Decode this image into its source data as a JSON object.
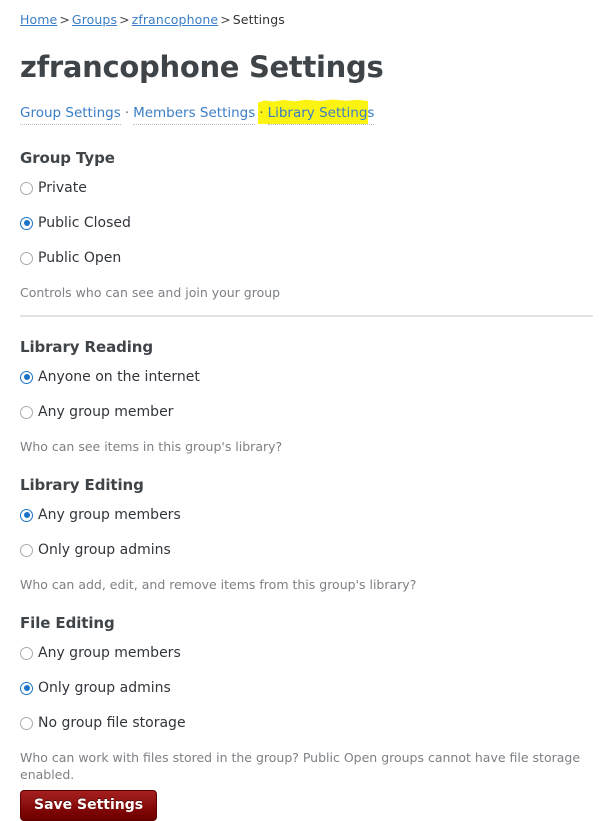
{
  "breadcrumb": {
    "items": [
      {
        "label": "Home",
        "link": true
      },
      {
        "label": "Groups",
        "link": true
      },
      {
        "label": "zfrancophone",
        "link": true
      },
      {
        "label": "Settings",
        "link": false
      }
    ],
    "separator": ">"
  },
  "header": {
    "title": "zfrancophone Settings"
  },
  "tabs": {
    "separator": "·",
    "items": [
      {
        "label": "Group Settings",
        "highlighted": false
      },
      {
        "label": "Members Settings",
        "highlighted": false
      },
      {
        "label": "Library Settings",
        "highlighted": true
      }
    ]
  },
  "sections": [
    {
      "title": "Group Type",
      "options": [
        {
          "label": "Private",
          "selected": false
        },
        {
          "label": "Public Closed",
          "selected": true
        },
        {
          "label": "Public Open",
          "selected": false
        }
      ],
      "helper": "Controls who can see and join your group"
    },
    {
      "title": "Library Reading",
      "options": [
        {
          "label": "Anyone on the internet",
          "selected": true
        },
        {
          "label": "Any group member",
          "selected": false
        }
      ],
      "helper": "Who can see items in this group's library?"
    },
    {
      "title": "Library Editing",
      "options": [
        {
          "label": "Any group members",
          "selected": true
        },
        {
          "label": "Only group admins",
          "selected": false
        }
      ],
      "helper": "Who can add, edit, and remove items from this group's library?"
    },
    {
      "title": "File Editing",
      "options": [
        {
          "label": "Any group members",
          "selected": false
        },
        {
          "label": "Only group admins",
          "selected": true
        },
        {
          "label": "No group file storage",
          "selected": false
        }
      ],
      "helper": "Who can work with files stored in the group? Public Open groups cannot have file storage enabled."
    }
  ],
  "actions": {
    "save_label": "Save Settings"
  },
  "colors": {
    "link": "#3a7ec6",
    "highlight": "#fbf312",
    "radio_selected": "#1a73c8",
    "radio_unselected": "#a8abb0",
    "save_button": "#931414",
    "heading": "#3f4449",
    "helper_text": "#7d8085"
  }
}
